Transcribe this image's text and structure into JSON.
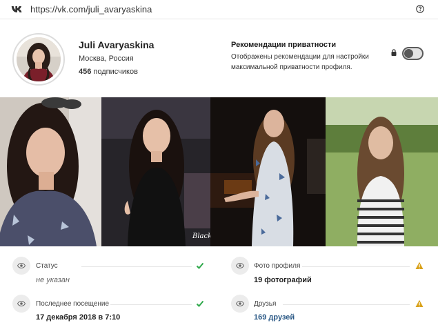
{
  "browser": {
    "url": "https://vk.com/juli_avaryaskina"
  },
  "profile": {
    "name": "Juli Avaryaskina",
    "city": "Москва, Россия",
    "subscribers_count": "456",
    "subscribers_label": "подписчиков"
  },
  "privacy": {
    "title": "Рекомендации приватности",
    "description": "Отображены рекомендации для настройки максимальной приватности профиля.",
    "toggle_on": false
  },
  "photos_watermark": "Black Milk",
  "info": {
    "status": {
      "label": "Статус",
      "value": "не указан",
      "state": "ok"
    },
    "last_seen": {
      "label": "Последнее посещение",
      "value": "17 декабря 2018 в 7:10",
      "state": "ok"
    },
    "profile_photos": {
      "label": "Фото профиля",
      "value": "19 фотографий",
      "state": "warning"
    },
    "friends": {
      "label": "Друзья",
      "value": "169 друзей",
      "state": "warning"
    }
  },
  "colors": {
    "ok": "#2ea84a",
    "warning": "#d9a21b",
    "link": "#2a5885",
    "toggle": "#5a5a5a"
  },
  "icons": [
    "vk-logo-icon",
    "help-circle-icon",
    "lock-icon",
    "eye-icon",
    "check-icon",
    "warning-triangle-icon"
  ]
}
